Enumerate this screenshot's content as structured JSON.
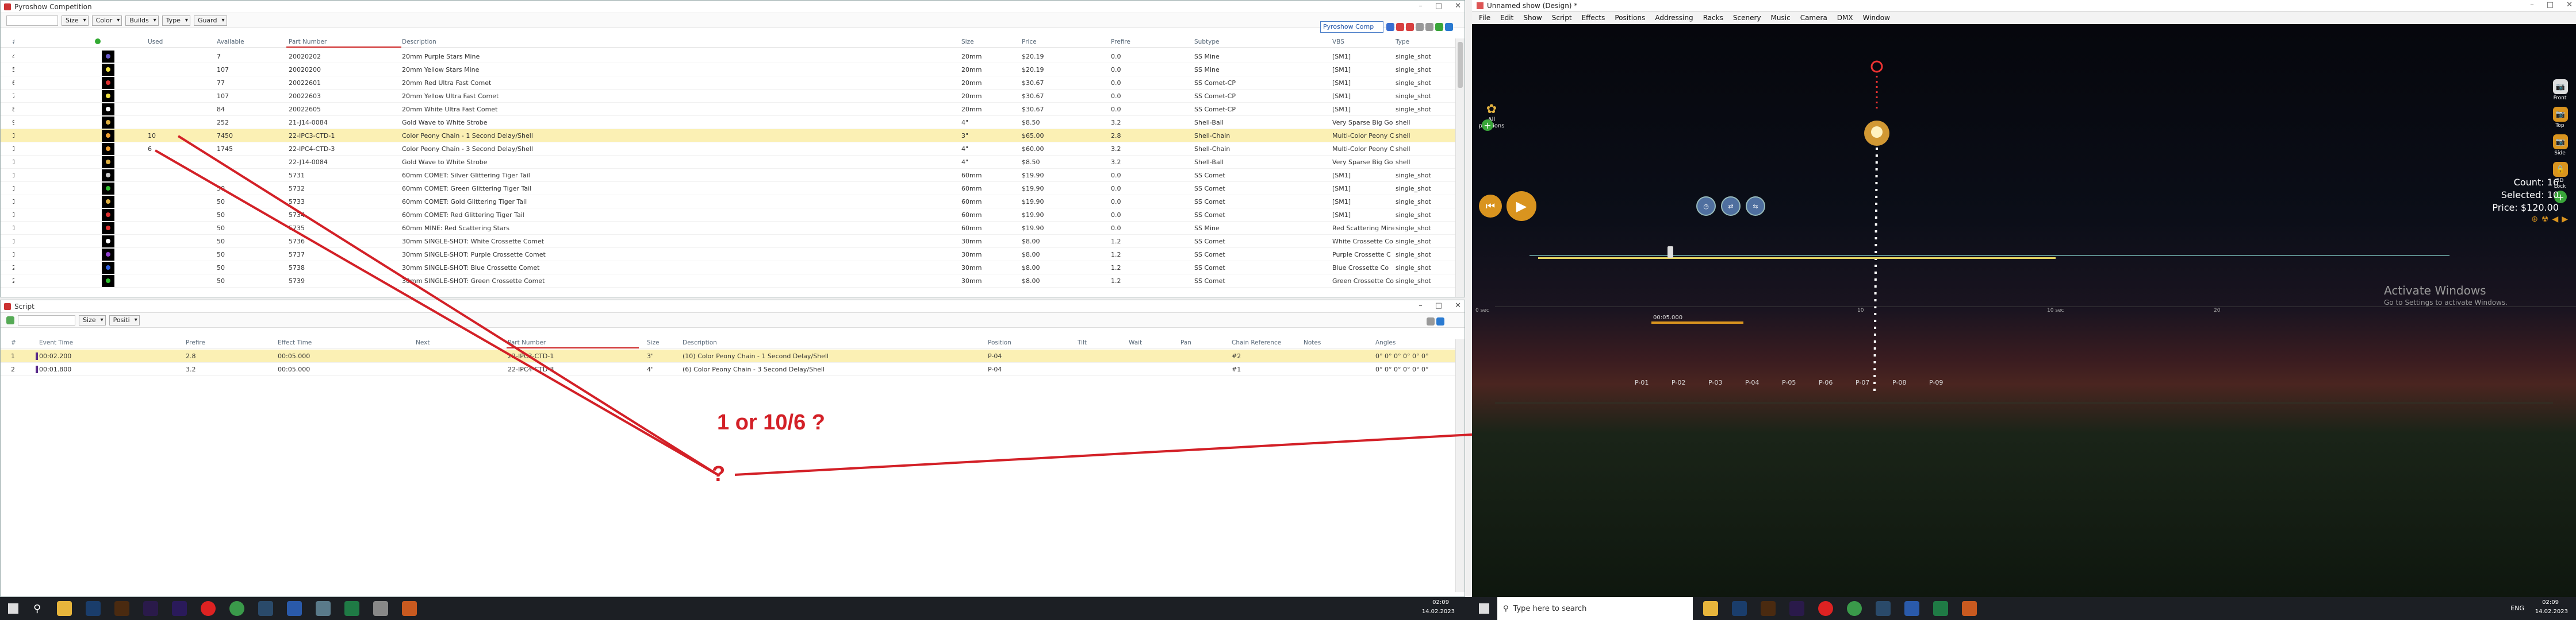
{
  "left_monitor": {
    "competition_window": {
      "title": "Pyroshow Competition",
      "toolbar": {
        "filters": [
          "Size",
          "Color",
          "Builds",
          "Type",
          "Guard"
        ]
      },
      "search_value": "Pyroshow Comp",
      "columns": [
        "#",
        "",
        "Used",
        "Available",
        "Part Number",
        "Description",
        "Size",
        "Price",
        "Prefire",
        "Subtype",
        "VBS",
        "Type"
      ],
      "rows": [
        {
          "n": "4",
          "dot": "#6a5acd",
          "used": "",
          "avail": "7",
          "part": "20020202",
          "desc": "20mm Purple Stars Mine",
          "size": "20mm",
          "price": "$20.19",
          "prefire": "0.0",
          "subtype": "SS Mine",
          "vbs": "[SM1]",
          "type": "single_shot"
        },
        {
          "n": "5",
          "dot": "#f0e040",
          "used": "",
          "avail": "107",
          "part": "20020200",
          "desc": "20mm Yellow Stars Mine",
          "size": "20mm",
          "price": "$20.19",
          "prefire": "0.0",
          "subtype": "SS Mine",
          "vbs": "[SM1]",
          "type": "single_shot"
        },
        {
          "n": "6",
          "dot": "#e03030",
          "used": "",
          "avail": "77",
          "part": "20022601",
          "desc": "20mm Red Ultra Fast Comet",
          "size": "20mm",
          "price": "$30.67",
          "prefire": "0.0",
          "subtype": "SS Comet-CP",
          "vbs": "[SM1]",
          "type": "single_shot"
        },
        {
          "n": "7",
          "dot": "#f0e040",
          "used": "",
          "avail": "107",
          "part": "20022603",
          "desc": "20mm Yellow Ultra Fast Comet",
          "size": "20mm",
          "price": "$30.67",
          "prefire": "0.0",
          "subtype": "SS Comet-CP",
          "vbs": "[SM1]",
          "type": "single_shot"
        },
        {
          "n": "8",
          "dot": "#ffffff",
          "used": "",
          "avail": "84",
          "part": "20022605",
          "desc": "20mm White Ultra Fast Comet",
          "size": "20mm",
          "price": "$30.67",
          "prefire": "0.0",
          "subtype": "SS Comet-CP",
          "vbs": "[SM1]",
          "type": "single_shot"
        },
        {
          "n": "9",
          "dot": "#e0b040",
          "used": "",
          "avail": "252",
          "part": "21-J14-0084",
          "desc": "Gold Wave to White Strobe",
          "size": "4\"",
          "price": "$8.50",
          "prefire": "3.2",
          "subtype": "Shell-Ball",
          "vbs": "Very Sparse Big Go",
          "type": "shell"
        },
        {
          "n": "10",
          "dot": "#f0a030",
          "used": "10",
          "avail": "7450",
          "part": "22-IPC3-CTD-1",
          "desc": "Color Peony Chain - 1 Second Delay/Shell",
          "size": "3\"",
          "price": "$65.00",
          "prefire": "2.8",
          "subtype": "Shell-Chain",
          "vbs": "Multi-Color Peony C",
          "type": "shell",
          "selected": true
        },
        {
          "n": "11",
          "dot": "#f0a030",
          "used": "6",
          "avail": "1745",
          "part": "22-IPC4-CTD-3",
          "desc": "Color Peony Chain - 3 Second Delay/Shell",
          "size": "4\"",
          "price": "$60.00",
          "prefire": "3.2",
          "subtype": "Shell-Chain",
          "vbs": "Multi-Color Peony C",
          "type": "shell"
        },
        {
          "n": "12",
          "dot": "#e0b040",
          "used": "",
          "avail": "",
          "part": "22-J14-0084",
          "desc": "Gold Wave to White Strobe",
          "size": "4\"",
          "price": "$8.50",
          "prefire": "3.2",
          "subtype": "Shell-Ball",
          "vbs": "Very Sparse Big Go",
          "type": "shell"
        },
        {
          "n": "13",
          "dot": "#cccccc",
          "used": "",
          "avail": "",
          "part": "5731",
          "desc": "60mm COMET: Silver Glittering Tiger Tail",
          "size": "60mm",
          "price": "$19.90",
          "prefire": "0.0",
          "subtype": "SS Comet",
          "vbs": "[SM1]",
          "type": "single_shot"
        },
        {
          "n": "14",
          "dot": "#30c030",
          "used": "",
          "avail": "50",
          "part": "5732",
          "desc": "60mm COMET: Green Glittering Tiger Tail",
          "size": "60mm",
          "price": "$19.90",
          "prefire": "0.0",
          "subtype": "SS Comet",
          "vbs": "[SM1]",
          "type": "single_shot"
        },
        {
          "n": "15",
          "dot": "#e0b040",
          "used": "",
          "avail": "50",
          "part": "5733",
          "desc": "60mm COMET: Gold Glittering Tiger Tail",
          "size": "60mm",
          "price": "$19.90",
          "prefire": "0.0",
          "subtype": "SS Comet",
          "vbs": "[SM1]",
          "type": "single_shot"
        },
        {
          "n": "16",
          "dot": "#e03030",
          "used": "",
          "avail": "50",
          "part": "5734",
          "desc": "60mm COMET: Red Glittering Tiger Tail",
          "size": "60mm",
          "price": "$19.90",
          "prefire": "0.0",
          "subtype": "SS Comet",
          "vbs": "[SM1]",
          "type": "single_shot"
        },
        {
          "n": "17",
          "dot": "#e03030",
          "used": "",
          "avail": "50",
          "part": "5735",
          "desc": "60mm MINE: Red Scattering Stars",
          "size": "60mm",
          "price": "$19.90",
          "prefire": "0.0",
          "subtype": "SS Mine",
          "vbs": "Red Scattering Mine",
          "type": "single_shot"
        },
        {
          "n": "18",
          "dot": "#ffffff",
          "used": "",
          "avail": "50",
          "part": "5736",
          "desc": "30mm SINGLE-SHOT: White Crossette Comet",
          "size": "30mm",
          "price": "$8.00",
          "prefire": "1.2",
          "subtype": "SS Comet",
          "vbs": "White Crossette Co",
          "type": "single_shot"
        },
        {
          "n": "19",
          "dot": "#9040d0",
          "used": "",
          "avail": "50",
          "part": "5737",
          "desc": "30mm SINGLE-SHOT: Purple Crossette Comet",
          "size": "30mm",
          "price": "$8.00",
          "prefire": "1.2",
          "subtype": "SS Comet",
          "vbs": "Purple Crossette C",
          "type": "single_shot"
        },
        {
          "n": "20",
          "dot": "#3060e0",
          "used": "",
          "avail": "50",
          "part": "5738",
          "desc": "30mm SINGLE-SHOT: Blue Crossette Comet",
          "size": "30mm",
          "price": "$8.00",
          "prefire": "1.2",
          "subtype": "SS Comet",
          "vbs": "Blue Crossette Co",
          "type": "single_shot"
        },
        {
          "n": "21",
          "dot": "#30c030",
          "used": "",
          "avail": "50",
          "part": "5739",
          "desc": "30mm SINGLE-SHOT: Green Crossette Comet",
          "size": "30mm",
          "price": "$8.00",
          "prefire": "1.2",
          "subtype": "SS Comet",
          "vbs": "Green Crossette Co",
          "type": "single_shot"
        }
      ]
    },
    "script_window": {
      "title": "Script",
      "toolbar": {
        "filters": [
          "Size",
          "Positi"
        ]
      },
      "columns": [
        "#",
        "Event Time",
        "Prefire",
        "Effect Time",
        "Next",
        "Part Number",
        "Size",
        "Description",
        "Position",
        "Tilt",
        "Wait",
        "Pan",
        "Chain Reference",
        "Notes",
        "Angles"
      ],
      "rows": [
        {
          "n": "1",
          "event": "00:02.200",
          "prefire": "2.8",
          "effect": "00:05.000",
          "next": "",
          "part": "22-IPC3-CTD-1",
          "size": "3\"",
          "desc": "(10) Color Peony Chain - 1 Second Delay/Shell",
          "pos": "P-04",
          "tilt": "",
          "wait": "",
          "pan": "",
          "chain": "#2",
          "notes": "",
          "angles": "0° 0° 0° 0° 0° 0°",
          "selected": true
        },
        {
          "n": "2",
          "event": "00:01.800",
          "prefire": "3.2",
          "effect": "00:05.000",
          "next": "",
          "part": "22-IPC4-CTD-3",
          "size": "4\"",
          "desc": "(6) Color Peony Chain - 3 Second Delay/Shell",
          "pos": "P-04",
          "tilt": "",
          "wait": "",
          "pan": "",
          "chain": "#1",
          "notes": "",
          "angles": "0° 0° 0° 0° 0° 0°"
        }
      ]
    },
    "annotation": {
      "question_main": "1 or 10/6 ?",
      "question_mark": "?",
      "color": "#d32027"
    },
    "taskbar": {
      "time": "02:09",
      "date": "14.02.2023"
    }
  },
  "right_monitor": {
    "window_title": "Unnamed show (Design) *",
    "menu": [
      "File",
      "Edit",
      "Show",
      "Script",
      "Effects",
      "Positions",
      "Addressing",
      "Racks",
      "Scenery",
      "Music",
      "Camera",
      "DMX",
      "Window"
    ],
    "positions_button": "All positions",
    "position_labels": [
      "P-01",
      "P-02",
      "P-03",
      "P-04",
      "P-05",
      "P-06",
      "P-07",
      "P-08",
      "P-09"
    ],
    "side_buttons": [
      "Front",
      "Top",
      "Side",
      "3D Lock"
    ],
    "stats": {
      "count": "Count: 16",
      "selected": "Selected: 10",
      "price": "Price: $120.00"
    },
    "timeline": {
      "current": "00:05.000",
      "ticks": [
        "0 sec",
        "10",
        "10 sec",
        "20"
      ]
    },
    "activate": {
      "title": "Activate Windows",
      "subtitle": "Go to Settings to activate Windows."
    },
    "taskbar": {
      "search": "Type here to search",
      "lang": "ENG",
      "time": "02:09",
      "date": "14.02.2023"
    }
  }
}
